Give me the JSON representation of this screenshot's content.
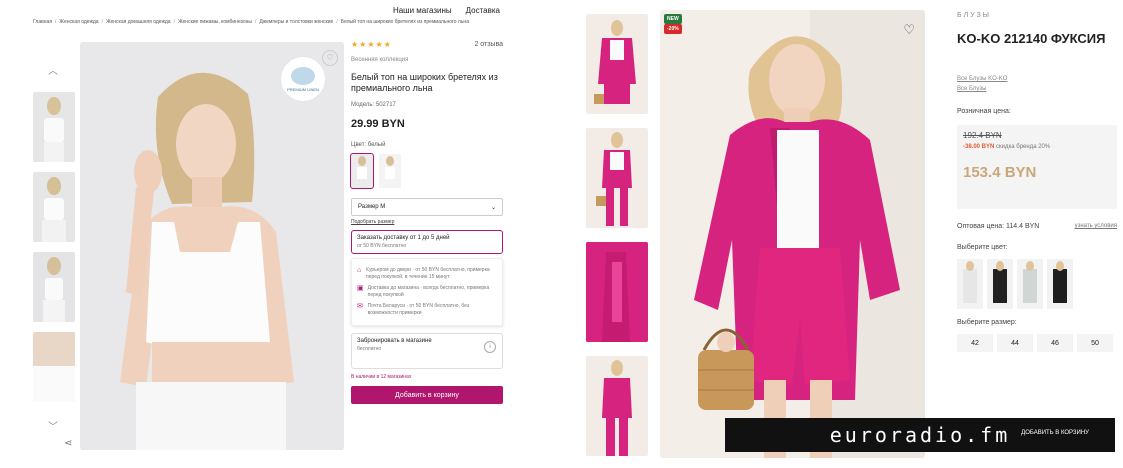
{
  "left": {
    "topnav": [
      "Наши магазины",
      "Доставка"
    ],
    "breadcrumbs": [
      "Главная",
      "Женская одежда",
      "Женская домашняя одежда",
      "Женские пижамы, комбинезоны",
      "Джемперы и толстовки женские",
      "Белый топ на широких бретелях из премиального льна"
    ],
    "stars": "★★★★★",
    "reviews": "2 отзыва",
    "collection": "Весенняя коллекция",
    "badge_text": "ECO",
    "badge_sub": "PREMIUM LINEN",
    "title": "Белый топ на широких бретелях из премиального льна",
    "model": "Модель: 502717",
    "price": "29.99 BYN",
    "color_label": "Цвет: белый",
    "size_value": "Размер M",
    "size_link": "Подобрать размер",
    "delivery_title": "Заказать доставку от 1 до 5 дней",
    "delivery_sub": "от 50 BYN бесплатно",
    "delivery_options": [
      {
        "icon": "courier-icon",
        "text": "Курьером до двери · от 50 BYN бесплатно, примерка перед покупкой, в течение 15 минут"
      },
      {
        "icon": "store-pickup-icon",
        "text": "Доставка до магазина · всегда бесплатно, примерка перед покупкой"
      },
      {
        "icon": "post-icon",
        "text": "Почта Беларуси · от 50 BYN бесплатно, без возможности примерки"
      }
    ],
    "reserve_title": "Забронировать в магазине",
    "reserve_sub": "бесплатно",
    "stock_note": "В наличии в 12 магазинах",
    "add_to_cart": "Добавить в корзину"
  },
  "right": {
    "new_badge": "NEW",
    "discount_badge": "-20%",
    "category": "БЛУЗЫ",
    "title": "KO-KO 212140 ФУКСИЯ",
    "links": [
      "Все Блузы KO-KO",
      "Все Блузы"
    ],
    "retail_label": "Розничная цена:",
    "old_price": "192.4 BYN",
    "discount_text": "-38.00 BYN",
    "discount_note": "скидка бренда 20%",
    "new_price": "153.4 BYN",
    "wholesale_label": "Оптовая цена: 114.4 BYN",
    "wholesale_link": "узнать условия",
    "choose_color": "Выберите цвет:",
    "choose_size": "Выберите размер:",
    "sizes": [
      "42",
      "44",
      "46",
      "50"
    ],
    "watermark": "euroradio.fm",
    "overlay_text": "ДОБАВИТЬ В КОРЗИНУ"
  },
  "colors": {
    "accent": "#b0166e",
    "fuchsia": "#d6237f",
    "price_gold": "#c9a77a",
    "discount": "#e35d2d"
  }
}
